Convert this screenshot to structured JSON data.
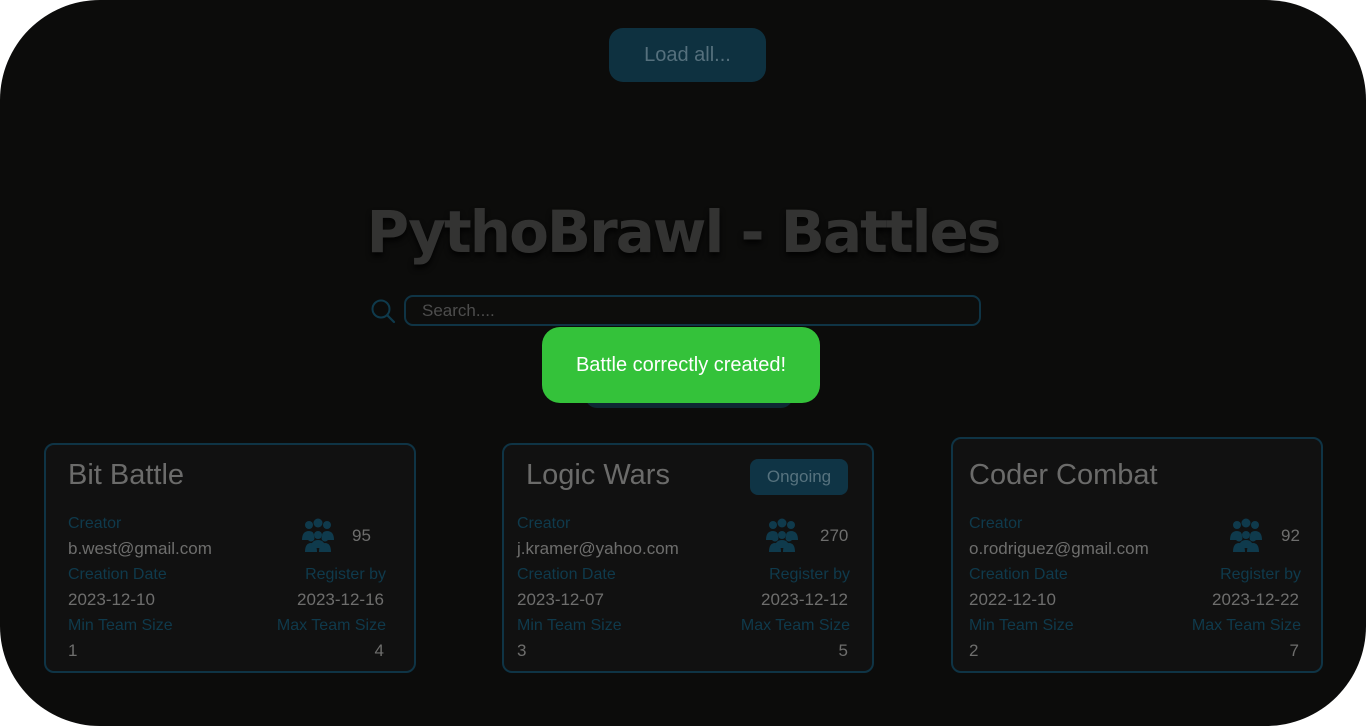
{
  "header": {
    "load_all_label": "Load all...",
    "title": "PythoBrawl - Battles"
  },
  "search": {
    "placeholder": "Search...."
  },
  "toast": {
    "message": "Battle correctly created!"
  },
  "labels": {
    "creator": "Creator",
    "creation_date": "Creation Date",
    "register_by": "Register  by",
    "min_team_size": "Min Team Size",
    "max_team_size": "Max Team Size"
  },
  "battles": [
    {
      "name": "Bit Battle",
      "creator": "b.west@gmail.com",
      "participants": "95",
      "creation_date": "2023-12-10",
      "register_by": "2023-12-16",
      "min_team_size": "1",
      "max_team_size": "4",
      "status": ""
    },
    {
      "name": "Logic Wars",
      "creator": "j.kramer@yahoo.com",
      "participants": "270",
      "creation_date": "2023-12-07",
      "register_by": "2023-12-12",
      "min_team_size": "3",
      "max_team_size": "5",
      "status": "Ongoing"
    },
    {
      "name": "Coder Combat",
      "creator": "o.rodriguez@gmail.com",
      "participants": "92",
      "creation_date": "2022-12-10",
      "register_by": "2023-12-22",
      "min_team_size": "2",
      "max_team_size": "7",
      "status": ""
    }
  ],
  "colors": {
    "background": "#0c0c0b",
    "accent": "#0f3445",
    "toast": "#34c23a"
  }
}
